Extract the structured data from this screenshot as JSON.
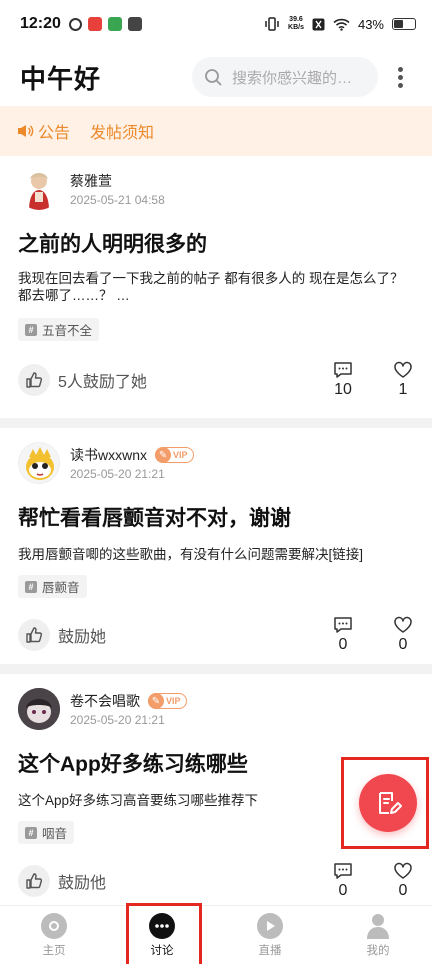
{
  "status_bar": {
    "time": "12:20",
    "net_speed_value": "39.6",
    "net_speed_unit": "KB/s",
    "battery_percent": "43%",
    "battery_level": 0.43
  },
  "header": {
    "title": "中午好",
    "search_placeholder": "搜索你感兴趣的…"
  },
  "notice": {
    "announcement_label": "公告",
    "posting_rules_label": "发帖须知"
  },
  "posts": [
    {
      "author": "蔡雅萱",
      "date": "2025-05-21 04:58",
      "vip": false,
      "title": "之前的人明明很多的",
      "body": "我现在回去看了一下我之前的帖子  都有很多人的  现在是怎么了？\n都去哪了……？ …",
      "tag": "五音不全",
      "cheer_text": "5人鼓励了她",
      "comments": "10",
      "likes": "1"
    },
    {
      "author": "读书wxxwnx",
      "date": "2025-05-20 21:21",
      "vip": true,
      "vip_label": "VIP",
      "title": "帮忙看看唇颤音对不对，谢谢",
      "body": "我用唇颤音唧的这些歌曲，有没有什么问题需要解决[链接]",
      "tag": "唇颤音",
      "cheer_text": "鼓励她",
      "comments": "0",
      "likes": "0"
    },
    {
      "author": "卷不会唱歌",
      "date": "2025-05-20 21:21",
      "vip": true,
      "vip_label": "VIP",
      "title": "这个App好多练习练哪些",
      "body": "这个App好多练习高音要练习哪些推荐下",
      "tag": "咽音",
      "cheer_text": "鼓励他",
      "comments": "0",
      "likes": "0"
    }
  ],
  "bottom_nav": {
    "home": "主页",
    "discuss": "讨论",
    "live": "直播",
    "mine": "我的",
    "active": "discuss"
  },
  "colors": {
    "accent": "#f0484e",
    "notice": "#ec8a2b",
    "highlight_box": "#e5281f"
  }
}
